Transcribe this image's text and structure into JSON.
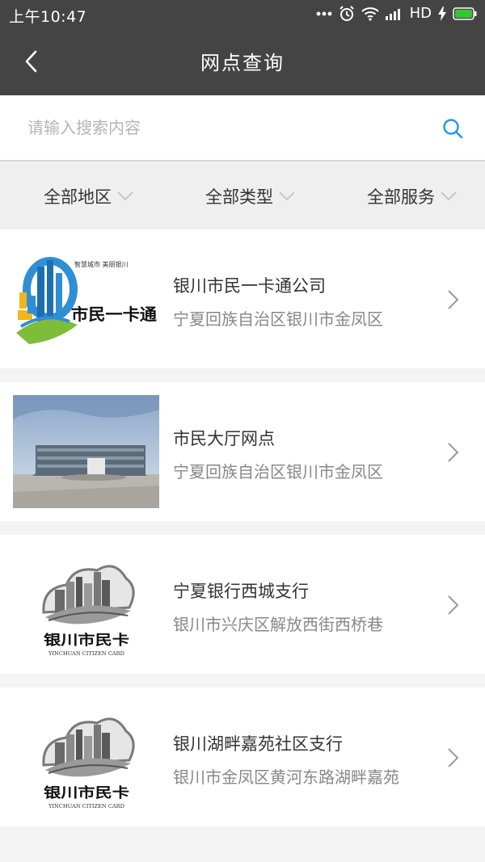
{
  "status_bar": {
    "time": "上午10:47",
    "network_label": "HD",
    "icons": [
      "more-dots-icon",
      "alarm-icon",
      "wifi-icon",
      "signal-icon",
      "charging-icon",
      "battery-icon"
    ],
    "battery_color": "#35c435"
  },
  "header": {
    "title": "网点查询",
    "back_icon": "back-arrow-icon",
    "background": "#444444"
  },
  "search": {
    "placeholder": "请输入搜索内容",
    "value": "",
    "icon": "search-icon",
    "icon_color": "#2196f3"
  },
  "filters": [
    {
      "label": "全部地区",
      "icon": "chevron-down-icon"
    },
    {
      "label": "全部类型",
      "icon": "chevron-down-icon"
    },
    {
      "label": "全部服务",
      "icon": "chevron-down-icon"
    }
  ],
  "outlets": [
    {
      "name": "银川市民一卡通公司",
      "address": "宁夏回族自治区银川市金凤区",
      "thumbnail": "citizen-card-color-logo",
      "logo_text": {
        "tagline": "智慧城市 美丽银川",
        "brand": "市民一卡通"
      }
    },
    {
      "name": "市民大厅网点",
      "address": "宁夏回族自治区银川市金凤区",
      "thumbnail": "citizen-hall-building-photo"
    },
    {
      "name": "宁夏银行西城支行",
      "address": "银川市兴庆区解放西街西桥巷",
      "thumbnail": "citizen-card-gray-logo",
      "logo_text": {
        "brand": "银川市民卡",
        "english": "YINCHUAN CITIZEN CARD"
      }
    },
    {
      "name": "银川湖畔嘉苑社区支行",
      "address": "银川市金凤区黄河东路湖畔嘉苑",
      "thumbnail": "citizen-card-gray-logo",
      "logo_text": {
        "brand": "银川市民卡",
        "english": "YINCHUAN CITIZEN CARD"
      }
    }
  ]
}
